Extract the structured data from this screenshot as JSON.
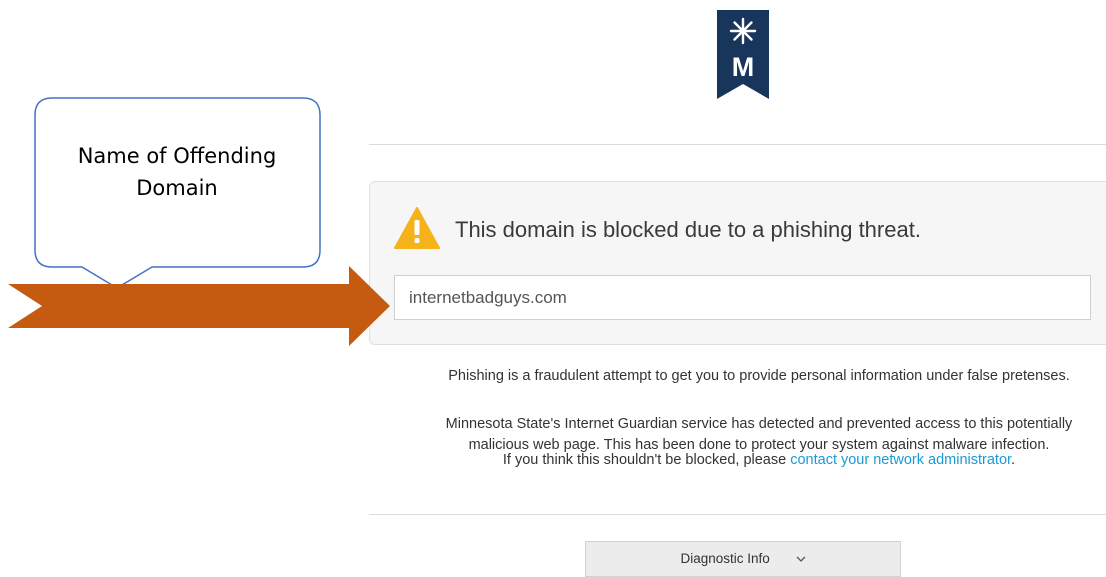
{
  "logo": {
    "icon": "minnesota-state-star-m-logo",
    "letter": "M",
    "color": "#18365b"
  },
  "alert": {
    "icon": "warning-triangle-icon",
    "icon_color": "#f5b21b",
    "title": "This domain is blocked due to a phishing threat.",
    "domain_value": "internetbadguys.com"
  },
  "body": {
    "phishing_definition": "Phishing is a fraudulent attempt to get you to provide personal information under false pretenses.",
    "guardian_line1": "Minnesota State's Internet Guardian service has detected and prevented access to this potentially",
    "guardian_line2": "malicious web page. This has been done to protect your system against malware infection.",
    "contact_prefix": "If you think this shouldn't be blocked, please ",
    "contact_link": "contact your network administrator",
    "contact_suffix": ".",
    "link_color": "#1a9ad6"
  },
  "diagnostic": {
    "label": "Diagnostic Info",
    "icon": "chevron-down-icon"
  },
  "annotation": {
    "callout_text": "Name of Offending Domain",
    "callout_border_color": "#4472c4",
    "arrow_color": "#c55a11"
  }
}
